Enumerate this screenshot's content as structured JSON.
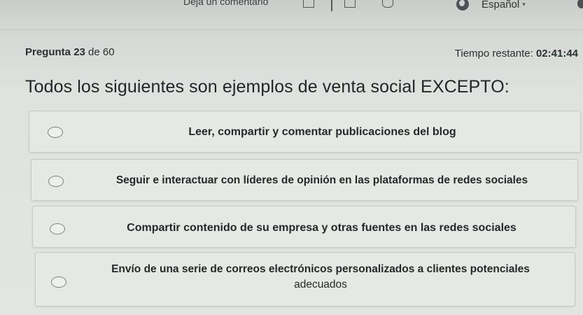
{
  "topbar": {
    "feedback_label": "Deja un comentario",
    "language": "Español",
    "language_icon": "globe-icon",
    "caret_icon": "chevron-down-icon"
  },
  "progress": {
    "label_prefix": "Pregunta",
    "current": "23",
    "separator": "de",
    "total": "60"
  },
  "timer": {
    "label": "Tiempo restante:",
    "value": "02:41:44"
  },
  "question": "Todos los siguientes son ejemplos de venta social EXCEPTO:",
  "options": [
    {
      "text": "Leer, compartir y comentar publicaciones del blog",
      "selected": false
    },
    {
      "text": "Seguir e interactuar con líderes de opinión en las plataformas de redes sociales",
      "selected": false
    },
    {
      "text": "Compartir contenido de su empresa y otras fuentes en las redes sociales",
      "selected": false
    },
    {
      "text": "Envío de una serie de correos electrónicos personalizados a clientes potenciales",
      "text_line2": "adecuados",
      "selected": false
    }
  ],
  "colors": {
    "background": "#e3e5e1",
    "option_bg": "#e6e8e4",
    "text": "#1e2326"
  }
}
